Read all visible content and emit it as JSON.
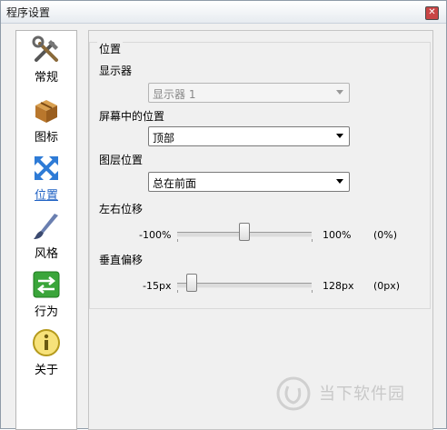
{
  "window": {
    "title": "程序设置",
    "close_symbol": "✕"
  },
  "sidebar": {
    "items": [
      {
        "label": "常规",
        "icon": "tools-icon"
      },
      {
        "label": "图标",
        "icon": "package-icon"
      },
      {
        "label": "位置",
        "icon": "move-arrows-icon",
        "active": true
      },
      {
        "label": "风格",
        "icon": "brush-icon"
      },
      {
        "label": "行为",
        "icon": "swap-arrows-icon"
      },
      {
        "label": "关于",
        "icon": "info-icon"
      }
    ]
  },
  "position": {
    "group_title": "位置",
    "monitor": {
      "label": "显示器",
      "value": "显示器 1",
      "disabled": true
    },
    "screen_position": {
      "label": "屏幕中的位置",
      "value": "顶部"
    },
    "layer": {
      "label": "图层位置",
      "value": "总在前面"
    },
    "horizontal": {
      "label": "左右位移",
      "min": "-100%",
      "max": "100%",
      "value_text": "(0%)",
      "fraction": 0.5
    },
    "vertical": {
      "label": "垂直偏移",
      "min": "-15px",
      "max": "128px",
      "value_text": "(0px)",
      "fraction": 0.105
    }
  },
  "watermark": {
    "text": "当下软件园"
  },
  "colors": {
    "accent": "#2062c4",
    "border": "#8f9ba8",
    "panel_bg": "#f0f0f0"
  }
}
